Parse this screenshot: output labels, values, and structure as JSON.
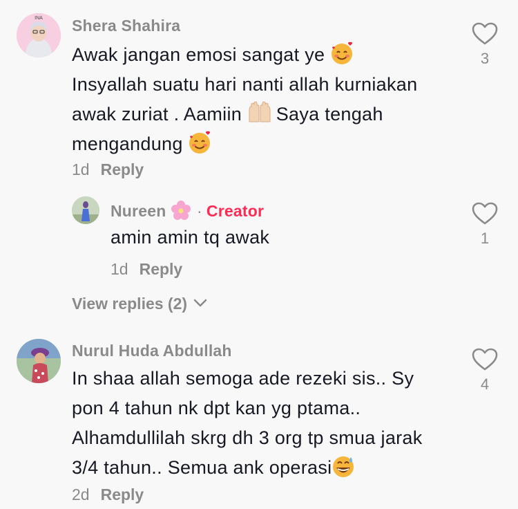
{
  "comments": [
    {
      "username": "Shera Shahira",
      "lines": [
        "Awak jangan emosi sangat ye",
        "Insyallah suatu hari nanti allah kurniakan",
        "awak zuriat . Aamiin",
        "Saya tengah",
        "mengandung"
      ],
      "age": "1d",
      "reply_label": "Reply",
      "likes": "3",
      "avatar_badge": "INA"
    },
    {
      "username": "Nurul Huda Abdullah",
      "lines": [
        "In shaa allah semoga ade rezeki sis.. Sy",
        "pon 4 tahun nk dpt kan yg ptama..",
        "Alhamdullilah skrg dh 3 org tp smua jarak",
        "3/4 tahun.. Semua ank operasi"
      ],
      "age": "2d",
      "reply_label": "Reply",
      "likes": "4"
    }
  ],
  "reply": {
    "username": "Nureen",
    "separator": "·",
    "creator_label": "Creator",
    "text": "amin amin tq awak",
    "age": "1d",
    "reply_label": "Reply",
    "likes": "1"
  },
  "view_replies": "View replies (2)",
  "icons": {
    "heart": "heart-outline-icon",
    "chevron": "chevron-down-icon",
    "emoji_love": "smiling-face-with-hearts-emoji",
    "emoji_hands": "raising-hands-emoji",
    "emoji_sweat": "grinning-face-with-sweat-emoji",
    "flower": "cherry-blossom-icon"
  },
  "colors": {
    "creator": "#fe2c55",
    "text": "#161823",
    "muted": "#8a8a8a",
    "background": "#f8f8f8"
  }
}
